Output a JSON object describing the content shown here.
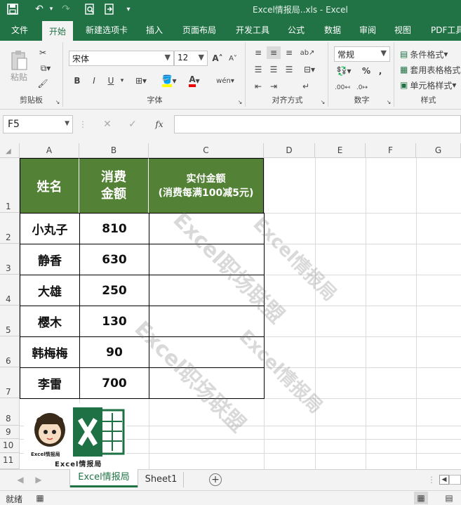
{
  "window": {
    "title": "Excel情报局..xls  -  Excel"
  },
  "ribbon_tabs": [
    "文件",
    "开始",
    "新建选项卡",
    "插入",
    "页面布局",
    "开发工具",
    "公式",
    "数据",
    "审阅",
    "视图",
    "PDF工具"
  ],
  "ribbon": {
    "clipboard": {
      "paste_label": "粘贴",
      "group_label": "剪贴板"
    },
    "font": {
      "name": "宋体",
      "size": "12",
      "grow": "A",
      "shrink": "A",
      "bold": "B",
      "italic": "I",
      "underline": "U",
      "phonetic": "wén",
      "group_label": "字体"
    },
    "alignment": {
      "group_label": "对齐方式"
    },
    "number": {
      "format": "常规",
      "percent": "%",
      "comma": ",",
      "group_label": "数字"
    },
    "styles": {
      "conditional": "条件格式",
      "table": "套用表格格式",
      "cell": "单元格样式",
      "group_label": "样式"
    }
  },
  "formula_bar": {
    "name_box": "F5",
    "fx": "fx",
    "value": ""
  },
  "columns": [
    "A",
    "B",
    "C",
    "D",
    "E",
    "F",
    "G"
  ],
  "rows": [
    "1",
    "2",
    "3",
    "4",
    "5",
    "6",
    "7",
    "8",
    "9",
    "10",
    "11"
  ],
  "table": {
    "headers": [
      "姓名",
      "消费\n金额",
      "实付金额\n(消费每满100减5元)"
    ],
    "rows": [
      {
        "name": "小丸子",
        "amount": "810",
        "paid": ""
      },
      {
        "name": "静香",
        "amount": "630",
        "paid": ""
      },
      {
        "name": "大雄",
        "amount": "250",
        "paid": ""
      },
      {
        "name": "樱木",
        "amount": "130",
        "paid": ""
      },
      {
        "name": "韩梅梅",
        "amount": "90",
        "paid": ""
      },
      {
        "name": "李雷",
        "amount": "700",
        "paid": ""
      }
    ]
  },
  "logo": {
    "caption": "Excel情报局",
    "small_caption": "Excel情报局"
  },
  "watermark": "Excel职场联盟",
  "watermark2": "Excel情报局",
  "sheets": {
    "tabs": [
      "Excel情报局",
      "Sheet1"
    ],
    "active": "Excel情报局"
  },
  "status": {
    "text": "就绪"
  },
  "colors": {
    "brand": "#217346",
    "header_fill": "#538135"
  }
}
